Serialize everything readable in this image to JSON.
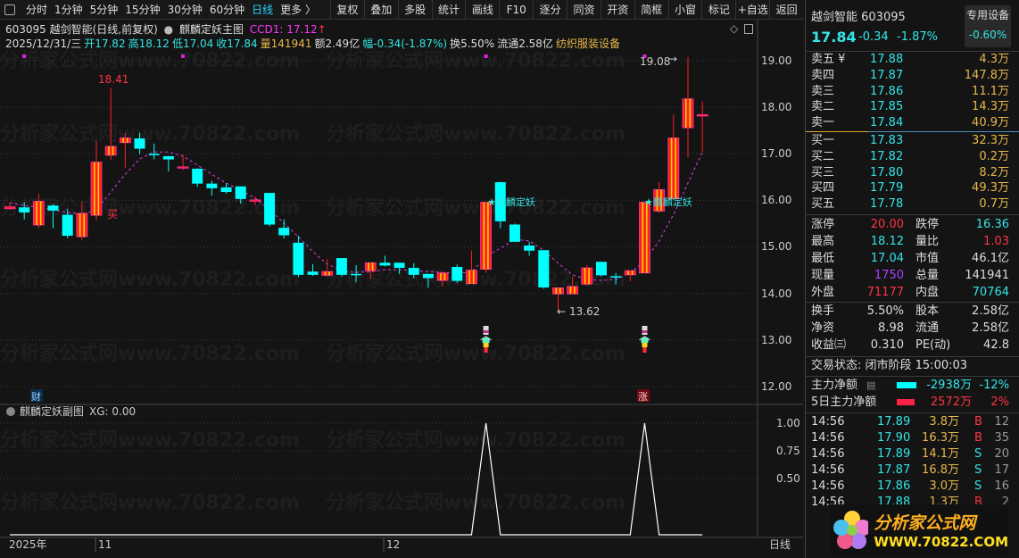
{
  "toolbar": {
    "periods": [
      "分时",
      "1分钟",
      "5分钟",
      "15分钟",
      "30分钟",
      "60分钟",
      "日线",
      "更多 〉"
    ],
    "active_period": "日线",
    "buttons": [
      "复权",
      "叠加",
      "多股",
      "统计",
      "画线",
      "F10",
      "逐分",
      "同资",
      "开资",
      "简框",
      "小窗",
      "标记",
      "+自选",
      "返回"
    ]
  },
  "header": {
    "title": "603095 越剑智能(日线,前复权)",
    "indicator": "麒麟定妖主图",
    "ccd1": "CCD1: 17.12",
    "ccd1_arrow": "↑",
    "date": "2025/12/31/三",
    "open": "开17.82",
    "high": "高18.12",
    "low": "低17.04",
    "close": "收17.84",
    "volume": "量141941",
    "amount": "额2.49亿",
    "range": "幅-0.34(-1.87%)",
    "turnover": "换5.50%",
    "float": "流通2.58亿",
    "industry": "纺织服装设备"
  },
  "watermark": "分析家公式网www.70822.com",
  "price_axis": [
    "19.00",
    "18.00",
    "17.00",
    "16.00",
    "15.00",
    "14.00",
    "13.00",
    "12.00"
  ],
  "sub_axis": [
    "1.00",
    "0.75",
    "0.50"
  ],
  "time_axis": {
    "year": "2025年",
    "m11": "11",
    "m12": "12",
    "period": "日线"
  },
  "annotations": {
    "high_label": "18.41",
    "peak_label": "19.08",
    "low_label": "13.62",
    "buy": "买",
    "signal": "★麒麟定妖",
    "cai": "财",
    "zhang": "涨"
  },
  "sub_header": {
    "title": "麒麟定妖副图",
    "xg": "XG: 0.00"
  },
  "chart_data": {
    "type": "candlestick",
    "price_range": [
      12,
      19
    ],
    "candles": [
      [
        15.82,
        15.95,
        15.8,
        15.86
      ],
      [
        15.85,
        15.96,
        15.59,
        15.74
      ],
      [
        15.47,
        16.15,
        15.4,
        15.98
      ],
      [
        15.89,
        15.92,
        15.4,
        15.78
      ],
      [
        15.69,
        15.82,
        15.19,
        15.24
      ],
      [
        15.22,
        15.97,
        15.15,
        15.72
      ],
      [
        15.68,
        17.28,
        15.57,
        16.82
      ],
      [
        16.97,
        18.41,
        16.87,
        17.16
      ],
      [
        17.24,
        17.45,
        16.7,
        17.34
      ],
      [
        17.33,
        17.45,
        16.99,
        17.11
      ],
      [
        17.0,
        17.22,
        16.88,
        16.97
      ],
      [
        16.95,
        16.95,
        16.62,
        16.88
      ],
      [
        16.7,
        16.98,
        16.65,
        16.72
      ],
      [
        16.68,
        16.69,
        16.29,
        16.36
      ],
      [
        16.36,
        16.42,
        16.1,
        16.26
      ],
      [
        16.28,
        16.37,
        16.14,
        16.18
      ],
      [
        16.3,
        16.3,
        15.93,
        16.03
      ],
      [
        15.99,
        16.08,
        15.89,
        16.01
      ],
      [
        16.16,
        16.16,
        15.44,
        15.48
      ],
      [
        15.41,
        15.59,
        15.18,
        15.25
      ],
      [
        15.09,
        15.24,
        14.35,
        14.4
      ],
      [
        14.47,
        14.63,
        14.38,
        14.4
      ],
      [
        14.39,
        14.74,
        14.37,
        14.47
      ],
      [
        14.76,
        14.76,
        14.37,
        14.4
      ],
      [
        14.42,
        14.61,
        14.24,
        14.4
      ],
      [
        14.49,
        14.66,
        14.31,
        14.66
      ],
      [
        14.66,
        14.81,
        14.58,
        14.6
      ],
      [
        14.66,
        14.66,
        14.42,
        14.55
      ],
      [
        14.55,
        14.65,
        14.33,
        14.4
      ],
      [
        14.42,
        14.42,
        14.12,
        14.33
      ],
      [
        14.28,
        14.44,
        14.15,
        14.44
      ],
      [
        14.57,
        14.62,
        14.23,
        14.27
      ],
      [
        14.21,
        14.92,
        14.21,
        14.5
      ],
      [
        14.52,
        15.96,
        14.44,
        15.96
      ],
      [
        16.39,
        16.4,
        15.4,
        15.55
      ],
      [
        15.48,
        15.5,
        15.11,
        15.11
      ],
      [
        15.03,
        15.11,
        14.81,
        14.92
      ],
      [
        14.93,
        14.93,
        14.1,
        14.13
      ],
      [
        13.99,
        14.12,
        13.62,
        14.12
      ],
      [
        13.99,
        14.36,
        13.99,
        14.15
      ],
      [
        14.2,
        14.61,
        14.17,
        14.55
      ],
      [
        14.68,
        14.68,
        14.37,
        14.39
      ],
      [
        14.37,
        14.44,
        14.2,
        14.35
      ],
      [
        14.4,
        14.49,
        14.26,
        14.49
      ],
      [
        14.44,
        15.96,
        14.44,
        15.96
      ],
      [
        15.77,
        16.39,
        15.73,
        16.23
      ],
      [
        16.03,
        17.84,
        16.03,
        17.34
      ],
      [
        17.56,
        19.08,
        16.92,
        18.18
      ],
      [
        17.82,
        18.12,
        17.04,
        17.84
      ]
    ],
    "ccd1": [
      15.95,
      15.89,
      15.85,
      15.8,
      15.74,
      15.7,
      15.8,
      16.18,
      16.56,
      16.89,
      17.04,
      17.04,
      16.95,
      16.76,
      16.56,
      16.37,
      16.22,
      16.05,
      15.8,
      15.51,
      15.22,
      14.9,
      14.63,
      14.49,
      14.45,
      14.47,
      14.51,
      14.51,
      14.49,
      14.47,
      14.45,
      14.44,
      14.45,
      14.8,
      14.97,
      15.16,
      15.13,
      14.93,
      14.65,
      14.4,
      14.3,
      14.28,
      14.3,
      14.44,
      14.7,
      15.13,
      15.7,
      16.37,
      17.04
    ],
    "signal_index": [
      33,
      44
    ],
    "xg": {
      "range": [
        0,
        1
      ],
      "values_nonzero_at": [
        33,
        44
      ]
    },
    "colors": {
      "up": "#ff2020",
      "up_stripe": "#ffd200",
      "up_edge": "#ff33aa",
      "down": "#00ffff",
      "ma": "#e040e0"
    }
  },
  "panel": {
    "name": "越剑智能 603095",
    "price": "17.84",
    "change": "-0.34",
    "pct": "-1.87%",
    "sector": "专用设备",
    "sector_pct": "-0.60%",
    "asks": [
      {
        "l": "卖五 ¥",
        "p": "17.88",
        "v": "4.3万"
      },
      {
        "l": "卖四",
        "p": "17.87",
        "v": "147.8万"
      },
      {
        "l": "卖三",
        "p": "17.86",
        "v": "11.1万"
      },
      {
        "l": "卖二",
        "p": "17.85",
        "v": "14.3万"
      },
      {
        "l": "卖一",
        "p": "17.84",
        "v": "40.9万"
      }
    ],
    "bids": [
      {
        "l": "买一",
        "p": "17.83",
        "v": "32.3万"
      },
      {
        "l": "买二",
        "p": "17.82",
        "v": "0.2万"
      },
      {
        "l": "买三",
        "p": "17.80",
        "v": "8.2万"
      },
      {
        "l": "买四",
        "p": "17.79",
        "v": "49.3万"
      },
      {
        "l": "买五",
        "p": "17.78",
        "v": "0.7万"
      }
    ],
    "stats": [
      {
        "l1": "涨停",
        "v1": "20.00",
        "l2": "跌停",
        "v2": "16.36"
      },
      {
        "l1": "最高",
        "v1": "18.12",
        "l2": "量比",
        "v2": "1.03"
      },
      {
        "l1": "最低",
        "v1": "17.04",
        "l2": "市值",
        "v2": "46.1亿"
      },
      {
        "l1": "现量",
        "v1": "1750",
        "l2": "总量",
        "v2": "141941"
      },
      {
        "l1": "外盘",
        "v1": "71177",
        "l2": "内盘",
        "v2": "70764"
      }
    ],
    "fund": [
      {
        "l1": "换手",
        "v1": "5.50%",
        "l2": "股本",
        "v2": "2.58亿"
      },
      {
        "l1": "净资",
        "v1": "8.98",
        "l2": "流通",
        "v2": "2.58亿"
      },
      {
        "l1": "收益㈢",
        "v1": "0.310",
        "l2": "PE(动)",
        "v2": "42.8"
      }
    ],
    "status": "交易状态: 闭市阶段 15:00:03",
    "flow": [
      {
        "l": "主力净额",
        "v": "-2938万",
        "p": "-12%"
      },
      {
        "l": "5日主力净额",
        "v": "2572万",
        "p": "2%"
      }
    ],
    "ticks": [
      {
        "t": "14:56",
        "p": "17.89",
        "v": "3.8万",
        "s": "B",
        "n": "12"
      },
      {
        "t": "14:56",
        "p": "17.90",
        "v": "16.3万",
        "s": "B",
        "n": "35"
      },
      {
        "t": "14:56",
        "p": "17.89",
        "v": "14.1万",
        "s": "S",
        "n": "20"
      },
      {
        "t": "14:56",
        "p": "17.87",
        "v": "16.8万",
        "s": "S",
        "n": "17"
      },
      {
        "t": "14:56",
        "p": "17.86",
        "v": "3.0万",
        "s": "S",
        "n": "16"
      },
      {
        "t": "14:56",
        "p": "17.88",
        "v": "1.3万",
        "s": "B",
        "n": "2"
      }
    ]
  },
  "logo": {
    "title": "分析家公式网",
    "url": "WWW.70822.COM"
  }
}
